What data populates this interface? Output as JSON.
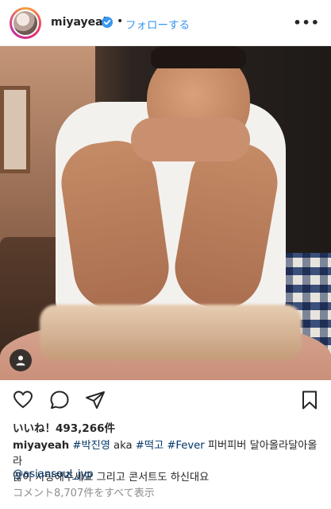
{
  "post": {
    "username": "miyayeah",
    "separator": "•",
    "follow_label": "フォローする",
    "more_label": "•••",
    "likes_text": "いいね！493,266件",
    "caption": {
      "username": "miyayeah",
      "tag1": "#박진영",
      "text1": " aka ",
      "tag2": "#떡고",
      "text2": " ",
      "tag3": "#Fever",
      "text3": " 피버피버 달아올라달아올라",
      "line2": "많이 사랑해주세요 그리고 콘서트도 하신대요"
    },
    "mention": "@asiansoul_jyp",
    "comments_link": "コメント8,707件をすべて表示"
  },
  "icons": {
    "verified": "verified-badge-icon",
    "user_tag": "user-tag-icon",
    "like": "heart-icon",
    "comment": "comment-icon",
    "share": "share-icon",
    "save": "bookmark-icon"
  },
  "colors": {
    "accent": "#3897f0",
    "link": "#003569",
    "muted": "#8e8e8e"
  }
}
